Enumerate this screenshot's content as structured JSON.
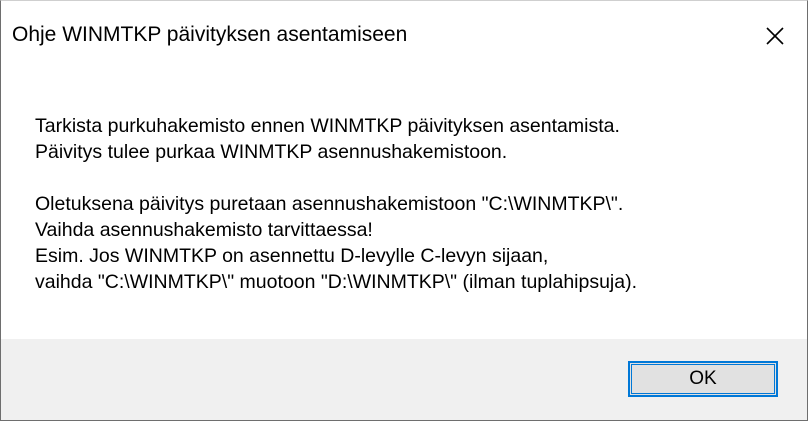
{
  "window": {
    "title": "Ohje WINMTKP päivityksen asentamiseen",
    "close_icon": "close-icon"
  },
  "message": {
    "lines": [
      "Tarkista purkuhakemisto ennen WINMTKP päivityksen asentamista.",
      "Päivitys tulee purkaa WINMTKP asennushakemistoon.",
      "Oletuksena päivitys puretaan asennushakemistoon \"C:\\WINMTKP\\\".",
      "Vaihda asennushakemisto tarvittaessa!",
      "Esim. Jos WINMTKP on asennettu D-levylle C-levyn sijaan,",
      "vaihda \"C:\\WINMTKP\\\" muotoon \"D:\\WINMTKP\\\" (ilman tuplahipsuja)."
    ]
  },
  "buttons": {
    "ok_label": "OK"
  },
  "colors": {
    "accent": "#0078d7",
    "footer_bg": "#f0f0f0",
    "button_bg": "#e1e1e1"
  }
}
